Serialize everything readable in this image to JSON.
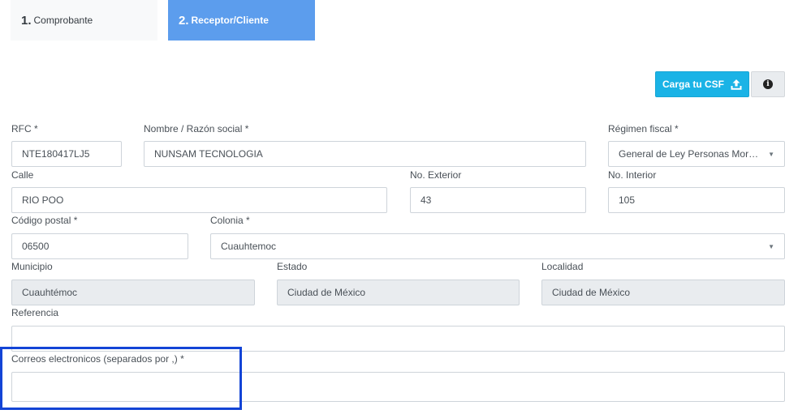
{
  "tabs": [
    {
      "num": "1.",
      "label": "Comprobante"
    },
    {
      "num": "2.",
      "label": "Receptor/Cliente"
    }
  ],
  "toolbar": {
    "csf_label": "Carga tu CSF",
    "upload_icon": "upload-icon",
    "info_icon": "info-icon",
    "info_glyph": "i"
  },
  "form": {
    "rfc": {
      "label": "RFC *",
      "value": "NTE180417LJ5"
    },
    "nombre": {
      "label": "Nombre / Razón social *",
      "value": "NUNSAM TECNOLOGIA"
    },
    "regimen": {
      "label": "Régimen fiscal *",
      "value": "General de Ley Personas Morales"
    },
    "calle": {
      "label": "Calle",
      "value": "RIO POO"
    },
    "no_exterior": {
      "label": "No. Exterior",
      "value": "43"
    },
    "no_interior": {
      "label": "No. Interior",
      "value": "105"
    },
    "codigo_postal": {
      "label": "Código postal *",
      "value": "06500"
    },
    "colonia": {
      "label": "Colonia *",
      "value": "Cuauhtemoc"
    },
    "municipio": {
      "label": "Municipio",
      "value": "Cuauhtémoc"
    },
    "estado": {
      "label": "Estado",
      "value": "Ciudad de México"
    },
    "localidad": {
      "label": "Localidad",
      "value": "Ciudad de México"
    },
    "referencia": {
      "label": "Referencia",
      "value": ""
    },
    "correos": {
      "label": "Correos electronicos (separados por ,) *",
      "value": ""
    }
  },
  "colors": {
    "active_tab": "#5c9ded",
    "csf_button": "#1ab3e6",
    "highlight": "#1344d6",
    "disabled_bg": "#e9ecef"
  }
}
